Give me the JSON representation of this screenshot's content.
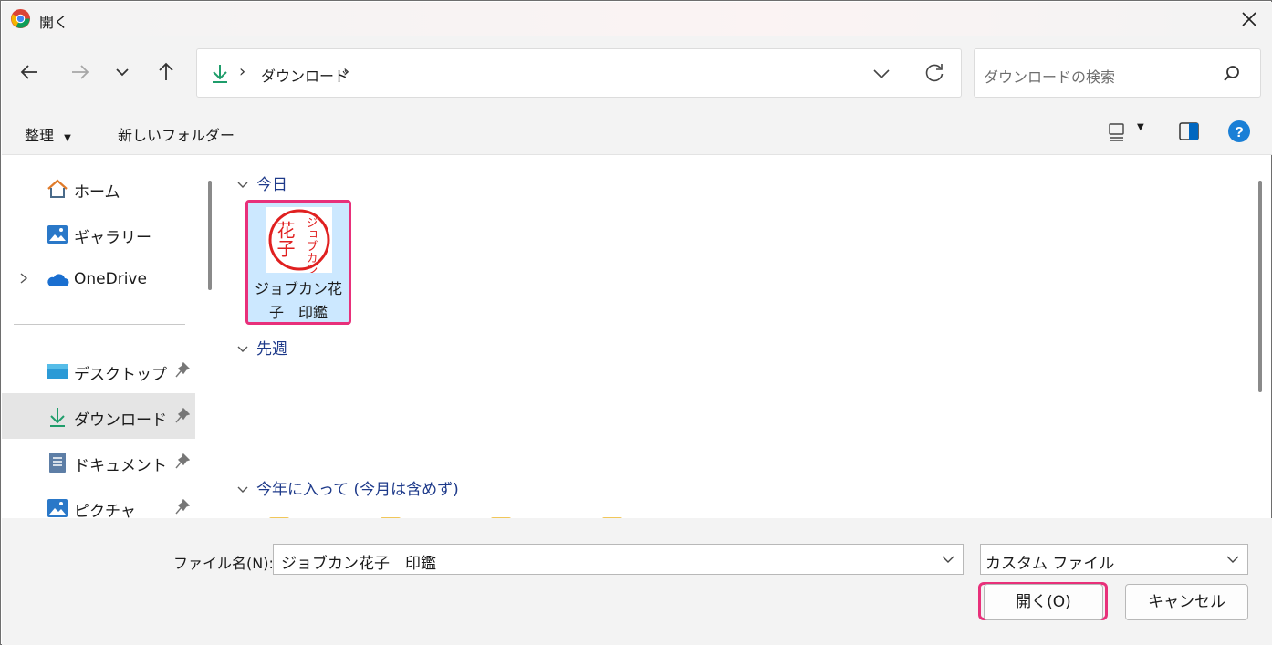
{
  "window": {
    "title": "開く",
    "app_icon": "chrome-icon",
    "close_icon": "close-icon"
  },
  "nav": {
    "back_icon": "back-arrow-icon",
    "forward_icon": "forward-arrow-icon",
    "recent_icon": "chevron-down-icon",
    "up_icon": "up-arrow-icon",
    "address": {
      "location_icon": "download-icon",
      "crumb": "ダウンロード",
      "separator": "›"
    },
    "refresh_icon": "refresh-icon",
    "search_placeholder": "ダウンロードの検索",
    "search_icon": "search-icon"
  },
  "commands": {
    "organize": "整理",
    "new_folder": "新しいフォルダー",
    "view_icon": "view-icon",
    "preview_pane_icon": "preview-pane-icon",
    "help_icon": "help-icon"
  },
  "sidebar": {
    "items": [
      {
        "label": "ホーム",
        "icon": "home-icon"
      },
      {
        "label": "ギャラリー",
        "icon": "gallery-icon"
      },
      {
        "label": "OneDrive",
        "icon": "onedrive-icon"
      },
      {
        "label": "デスクトップ",
        "icon": "desktop-icon",
        "pinned": true
      },
      {
        "label": "ダウンロード",
        "icon": "download-icon",
        "pinned": true,
        "selected": true
      },
      {
        "label": "ドキュメント",
        "icon": "document-icon",
        "pinned": true
      },
      {
        "label": "ピクチャ",
        "icon": "pictures-icon",
        "pinned": true
      }
    ]
  },
  "content": {
    "groups": [
      {
        "label": "今日"
      },
      {
        "label": "先週"
      },
      {
        "label": "今年に入って (今月は含めず)"
      }
    ],
    "files": [
      {
        "name_line1": "ジョブカン花",
        "name_line2": "子　印鑑",
        "seal_text_left": "花子",
        "seal_text_right": "ジョブカン"
      }
    ]
  },
  "footer": {
    "filename_label": "ファイル名(N):",
    "filename_value": "ジョブカン花子　印鑑",
    "filetype_value": "カスタム ファイル",
    "open_button": "開く(O)",
    "cancel_button": "キャンセル"
  },
  "colors": {
    "highlight": "#e8307a",
    "selection": "#cce8ff",
    "accent": "#0067c0",
    "seal_red": "#e02020"
  }
}
